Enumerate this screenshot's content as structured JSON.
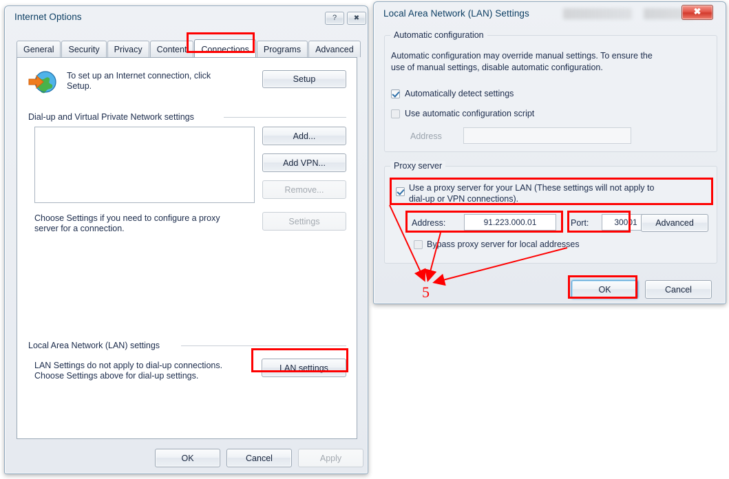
{
  "internet_options": {
    "title": "Internet Options",
    "titlebar_buttons": {
      "help": "?",
      "close": "✖"
    },
    "tabs": [
      {
        "label": "General",
        "active": false
      },
      {
        "label": "Security",
        "active": false
      },
      {
        "label": "Privacy",
        "active": false
      },
      {
        "label": "Content",
        "active": false
      },
      {
        "label": "Connections",
        "active": true
      },
      {
        "label": "Programs",
        "active": false
      },
      {
        "label": "Advanced",
        "active": false
      }
    ],
    "setup_row": {
      "icon": "globe-with-arrow-icon",
      "text": "To set up an Internet connection, click\nSetup.",
      "button": "Setup"
    },
    "dialup_group": {
      "label": "Dial-up and Virtual Private Network settings",
      "list_items": [],
      "buttons": [
        {
          "label": "Add...",
          "disabled": false
        },
        {
          "label": "Add VPN...",
          "disabled": false
        },
        {
          "label": "Remove...",
          "disabled": true
        },
        {
          "label": "Settings",
          "disabled": true
        }
      ],
      "hint": "Choose Settings if you need to configure a proxy\nserver for a connection."
    },
    "lan_group": {
      "label": "Local Area Network (LAN) settings",
      "text": "LAN Settings do not apply to dial-up connections.\nChoose Settings above for dial-up settings.",
      "button": "LAN settings"
    },
    "footer_buttons": [
      {
        "label": "OK",
        "disabled": false
      },
      {
        "label": "Cancel",
        "disabled": false
      },
      {
        "label": "Apply",
        "disabled": true
      }
    ]
  },
  "lan_settings": {
    "title": "Local Area Network (LAN) Settings",
    "titlebar_buttons": {
      "close": "✖"
    },
    "auto_config": {
      "group_label": "Automatic configuration",
      "description": "Automatic configuration may override manual settings.  To ensure the\nuse of manual settings, disable automatic configuration.",
      "auto_detect": {
        "label": "Automatically detect settings",
        "checked": true
      },
      "use_script": {
        "label": "Use automatic configuration script",
        "checked": false
      },
      "address_label": "Address",
      "address_value": "",
      "address_disabled": true
    },
    "proxy": {
      "group_label": "Proxy server",
      "use_proxy": {
        "label": "Use a proxy server for your LAN (These settings will not apply to\ndial-up or VPN connections).",
        "checked": true
      },
      "address_label": "Address:",
      "address_value": "91.223.000.01",
      "port_label": "Port:",
      "port_value": "30001",
      "advanced_button": "Advanced",
      "bypass": {
        "label": "Bypass proxy server for local addresses",
        "checked": false
      }
    },
    "footer_buttons": [
      {
        "label": "OK",
        "disabled": false,
        "focused": true
      },
      {
        "label": "Cancel",
        "disabled": false,
        "focused": false
      }
    ]
  },
  "annotations": {
    "step_number": "5",
    "highlight_color": "#fe0000",
    "highlighted": [
      "connections-tab",
      "lan-settings-button",
      "use-proxy-checkbox-row",
      "proxy-address-field",
      "proxy-port-field",
      "lan-ok-button"
    ]
  }
}
